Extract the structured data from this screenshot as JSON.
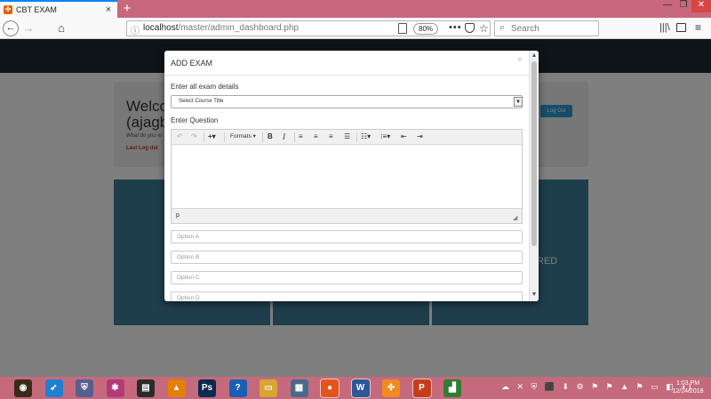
{
  "browser": {
    "tab_title": "CBT EXAM",
    "tab_close": "×",
    "new_tab": "+",
    "url_host": "localhost",
    "url_path": "/master/admin_dashboard.php",
    "zoom": "80%",
    "more_actions": "•••",
    "search_placeholder": "Search",
    "window_controls": {
      "minimize": "—",
      "maximize": "❐",
      "close": "✕"
    },
    "icons": {
      "back": "←",
      "forward": "→",
      "home": "⌂",
      "info": "ⓘ",
      "star": "☆",
      "search": "⌕",
      "library": "|||\\",
      "menu": "≡"
    }
  },
  "page": {
    "welcome_title": "Welco",
    "welcome_user": "(ajagbe",
    "welcome_sub": "What do you w",
    "last_log": "Last Log dat",
    "logout_label": "Log Out",
    "tile_label": "RED"
  },
  "modal": {
    "title": "ADD EXAM",
    "close": "×",
    "exam_details_label": "Enter all exam details",
    "course_select_value": "Select Course Title",
    "question_label": "Enter Question",
    "toolbar": {
      "undo": "↶",
      "redo": "↷",
      "insert": "+▾",
      "formats": "Formats ▾",
      "bold": "B",
      "italic": "I",
      "bullet_list": "☷▾",
      "numbered_list": "⁝≡▾",
      "outdent": "⇤",
      "indent": "⇥"
    },
    "status_path": "p",
    "resize_grip": "◢",
    "options": [
      {
        "placeholder": "Option A"
      },
      {
        "placeholder": "Option B"
      },
      {
        "placeholder": "Option C"
      },
      {
        "placeholder": "Option D"
      }
    ]
  },
  "taskbar": {
    "apps": [
      {
        "name": "media-player",
        "glyph": "◉",
        "color": "#3b2a1a"
      },
      {
        "name": "rocket",
        "glyph": "➶",
        "color": "#1f7fd1"
      },
      {
        "name": "xampp-shield",
        "glyph": "⛨",
        "color": "#55608f"
      },
      {
        "name": "app-colorful",
        "glyph": "✱",
        "color": "#b23a7a"
      },
      {
        "name": "film",
        "glyph": "▤",
        "color": "#2b2b2b"
      },
      {
        "name": "vlc",
        "glyph": "▲",
        "color": "#e67e00"
      },
      {
        "name": "photoshop",
        "glyph": "Ps",
        "color": "#0a2b4e"
      },
      {
        "name": "help",
        "glyph": "?",
        "color": "#1a5fb4"
      },
      {
        "name": "file-explorer",
        "glyph": "▭",
        "color": "#d9a634"
      },
      {
        "name": "network",
        "glyph": "▦",
        "color": "#4a6a8a"
      },
      {
        "name": "firefox",
        "glyph": "●",
        "color": "#e5541b"
      },
      {
        "name": "word",
        "glyph": "W",
        "color": "#2b5797"
      },
      {
        "name": "xampp",
        "glyph": "✣",
        "color": "#f18b21"
      },
      {
        "name": "powerpoint",
        "glyph": "P",
        "color": "#c43e1c"
      },
      {
        "name": "excel-chart",
        "glyph": "▟",
        "color": "#2f7d32"
      }
    ],
    "tray_icons": "☁ ✕ ⛨ ⬛ ⬇ ⚙ ⚑ ⚑ ▲ ⚑ ▭ ◧ ◖)",
    "time": "1:03 PM",
    "date": "12/24/2018"
  }
}
